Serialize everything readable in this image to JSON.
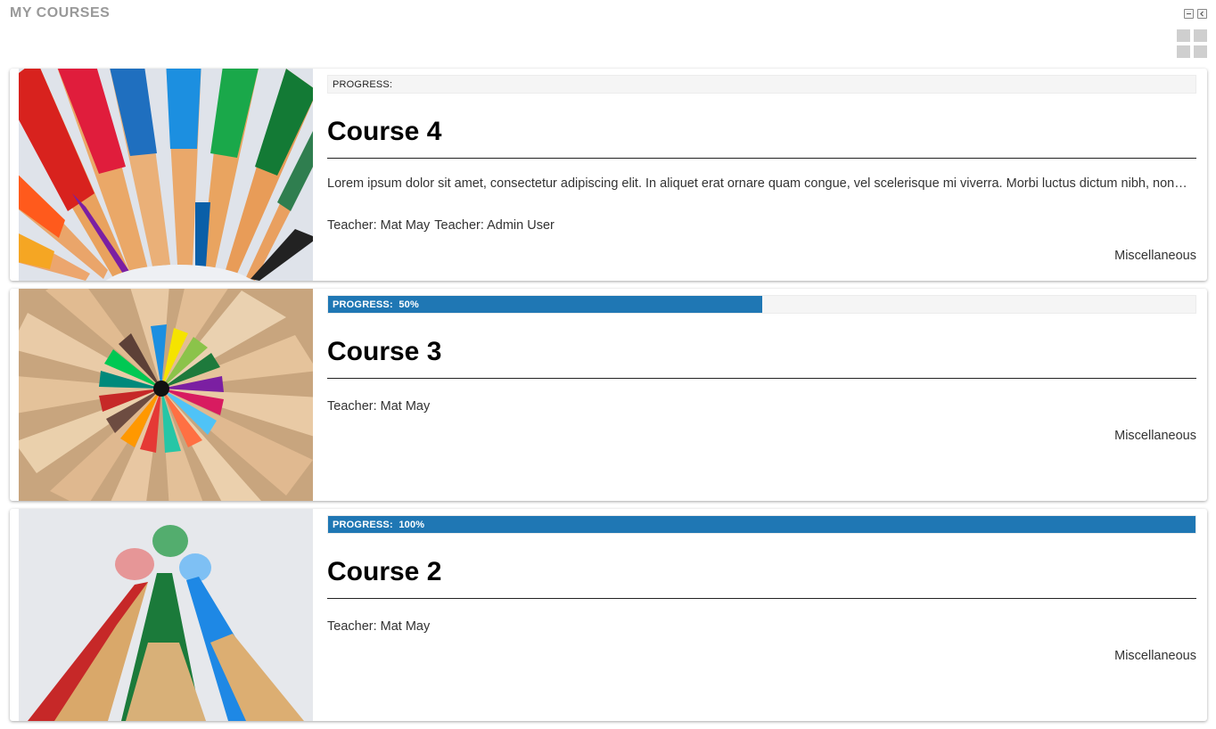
{
  "block": {
    "title": "MY COURSES"
  },
  "courses": [
    {
      "progress_text": "PROGRESS:",
      "progress_value": null,
      "progress_fraction": 0,
      "title": "Course 4",
      "summary": "Lorem ipsum dolor sit amet, consectetur adipiscing elit. In aliquet erat ornare quam congue, vel scelerisque mi viverra. Morbi luctus dictum nibh, non…",
      "teachers": [
        "Teacher: Mat May",
        "Teacher: Admin User"
      ],
      "category": "Miscellaneous",
      "image": "colored-pencils-fan"
    },
    {
      "progress_text": "PROGRESS:",
      "progress_value": "50%",
      "progress_fraction": 0.5,
      "title": "Course 3",
      "summary": "",
      "teachers": [
        "Teacher: Mat May"
      ],
      "category": "Miscellaneous",
      "image": "colored-pencils-circle"
    },
    {
      "progress_text": "PROGRESS:",
      "progress_value": "100%",
      "progress_fraction": 1.0,
      "title": "Course 2",
      "summary": "",
      "teachers": [
        "Teacher: Mat May"
      ],
      "category": "Miscellaneous",
      "image": "three-pencil-tips"
    }
  ],
  "colors": {
    "progress": "#1f77b4",
    "block_title": "#999999"
  },
  "icons": {
    "minimize": "minimize-icon",
    "dock": "dock-icon",
    "view_toggle": "grid-view-icon"
  }
}
